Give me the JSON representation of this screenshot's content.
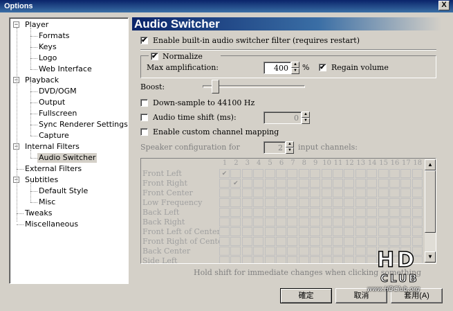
{
  "window": {
    "title": "Options",
    "close_label": "X"
  },
  "tree": {
    "items": [
      {
        "label": "Player",
        "level": 0,
        "expander": "−"
      },
      {
        "label": "Formats",
        "level": 1
      },
      {
        "label": "Keys",
        "level": 1
      },
      {
        "label": "Logo",
        "level": 1
      },
      {
        "label": "Web Interface",
        "level": 1
      },
      {
        "label": "Playback",
        "level": 0,
        "expander": "−"
      },
      {
        "label": "DVD/OGM",
        "level": 1
      },
      {
        "label": "Output",
        "level": 1
      },
      {
        "label": "Fullscreen",
        "level": 1
      },
      {
        "label": "Sync Renderer Settings",
        "level": 1
      },
      {
        "label": "Capture",
        "level": 1
      },
      {
        "label": "Internal Filters",
        "level": 0,
        "expander": "−"
      },
      {
        "label": "Audio Switcher",
        "level": 1,
        "selected": true
      },
      {
        "label": "External Filters",
        "level": 0
      },
      {
        "label": "Subtitles",
        "level": 0,
        "expander": "−"
      },
      {
        "label": "Default Style",
        "level": 1
      },
      {
        "label": "Misc",
        "level": 1
      },
      {
        "label": "Tweaks",
        "level": 0
      },
      {
        "label": "Miscellaneous",
        "level": 0
      }
    ]
  },
  "page": {
    "title": "Audio Switcher",
    "enable_switcher": {
      "label": "Enable built-in audio switcher filter (requires restart)",
      "checked": true
    },
    "normalize": {
      "label": "Normalize",
      "checked": true
    },
    "max_amp": {
      "label": "Max amplification:",
      "value": "400",
      "unit": "%"
    },
    "regain_volume": {
      "label": "Regain volume",
      "checked": true
    },
    "boost": {
      "label": "Boost:",
      "level": 0.1
    },
    "downsample": {
      "label": "Down-sample to 44100 Hz",
      "checked": false
    },
    "time_shift": {
      "label": "Audio time shift (ms):",
      "checked": false,
      "value": "0"
    },
    "custom_mapping": {
      "label": "Enable custom channel mapping",
      "checked": false
    },
    "speaker_config": {
      "prefix": "Speaker configuration for",
      "value": "2",
      "suffix": "input channels:"
    },
    "hint": "Hold shift for immediate changes when clicking something",
    "grid": {
      "columns": [
        "1",
        "2",
        "3",
        "4",
        "5",
        "6",
        "7",
        "8",
        "9",
        "10",
        "11",
        "12",
        "13",
        "14",
        "15",
        "16",
        "17",
        "18"
      ],
      "rows": [
        {
          "label": "Front Left",
          "checked_col": 0
        },
        {
          "label": "Front Right",
          "checked_col": 1
        },
        {
          "label": "Front Center",
          "checked_col": -1
        },
        {
          "label": "Low Frequency",
          "checked_col": -1
        },
        {
          "label": "Back Left",
          "checked_col": -1
        },
        {
          "label": "Back Right",
          "checked_col": -1
        },
        {
          "label": "Front Left of Center",
          "checked_col": -1
        },
        {
          "label": "Front Right of Center",
          "checked_col": -1
        },
        {
          "label": "Back Center",
          "checked_col": -1
        },
        {
          "label": "Side Left",
          "checked_col": -1
        }
      ],
      "check_glyph": "✔"
    }
  },
  "buttons": {
    "ok": "確定",
    "cancel": "取消",
    "apply": "套用(A)"
  },
  "watermark": {
    "line1": "HD",
    "line2": "CLUB",
    "url": "www.HDClub.org"
  }
}
